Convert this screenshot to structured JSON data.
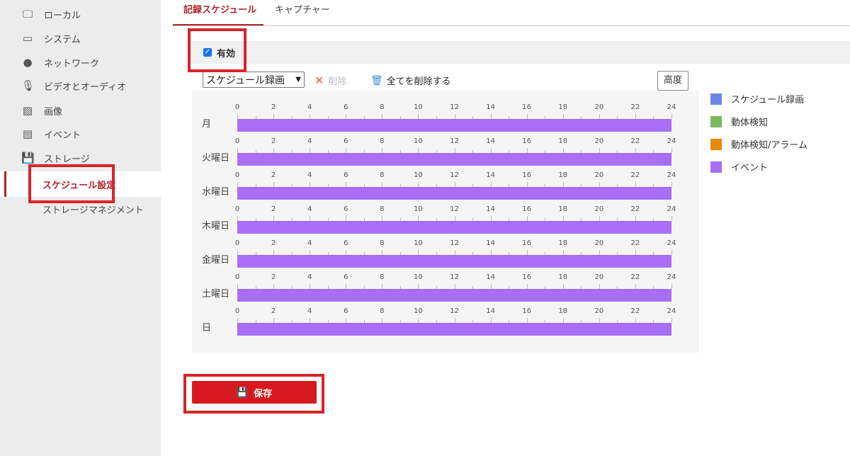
{
  "sidebar": {
    "items": [
      {
        "label": "ローカル",
        "icon": "monitor-icon"
      },
      {
        "label": "システム",
        "icon": "window-icon"
      },
      {
        "label": "ネットワーク",
        "icon": "globe-icon"
      },
      {
        "label": "ビデオとオーディオ",
        "icon": "microphone-camera-icon"
      },
      {
        "label": "画像",
        "icon": "image-icon"
      },
      {
        "label": "イベント",
        "icon": "calendar-icon"
      },
      {
        "label": "ストレージ",
        "icon": "floppy-disk-icon"
      }
    ],
    "subitems": [
      {
        "label": "スケジュール設定",
        "active": true
      },
      {
        "label": "ストレージマネジメント",
        "active": false
      }
    ]
  },
  "tabs": [
    {
      "label": "記録スケジュール",
      "active": true
    },
    {
      "label": "キャプチャー",
      "active": false
    }
  ],
  "enable": {
    "label": "有効",
    "checked": true
  },
  "toolbar": {
    "type_select": "スケジュール録画",
    "delete_label": "削除",
    "delete_all_label": "全てを削除する",
    "advanced_label": "高度"
  },
  "schedule": {
    "ticks": [
      "0",
      "2",
      "4",
      "6",
      "8",
      "10",
      "12",
      "14",
      "16",
      "18",
      "20",
      "22",
      "24"
    ],
    "days": [
      {
        "label": "月",
        "start": 0,
        "end": 24,
        "type": "イベント"
      },
      {
        "label": "火曜日",
        "start": 0,
        "end": 24,
        "type": "イベント"
      },
      {
        "label": "水曜日",
        "start": 0,
        "end": 24,
        "type": "イベント"
      },
      {
        "label": "木曜日",
        "start": 0,
        "end": 24,
        "type": "イベント"
      },
      {
        "label": "金曜日",
        "start": 0,
        "end": 24,
        "type": "イベント"
      },
      {
        "label": "土曜日",
        "start": 0,
        "end": 24,
        "type": "イベント"
      },
      {
        "label": "日",
        "start": 0,
        "end": 24,
        "type": "イベント"
      }
    ]
  },
  "legend": [
    {
      "label": "スケジュール録画",
      "color": "#6b86e6"
    },
    {
      "label": "動体検知",
      "color": "#7cb95e"
    },
    {
      "label": "動体検知/アラーム",
      "color": "#e8890c"
    },
    {
      "label": "イベント",
      "color": "#a86ef5"
    }
  ],
  "save_label": "保存",
  "colors": {
    "accent": "#b3232a",
    "save_button": "#d7191f",
    "annotation": "#d9232a"
  }
}
